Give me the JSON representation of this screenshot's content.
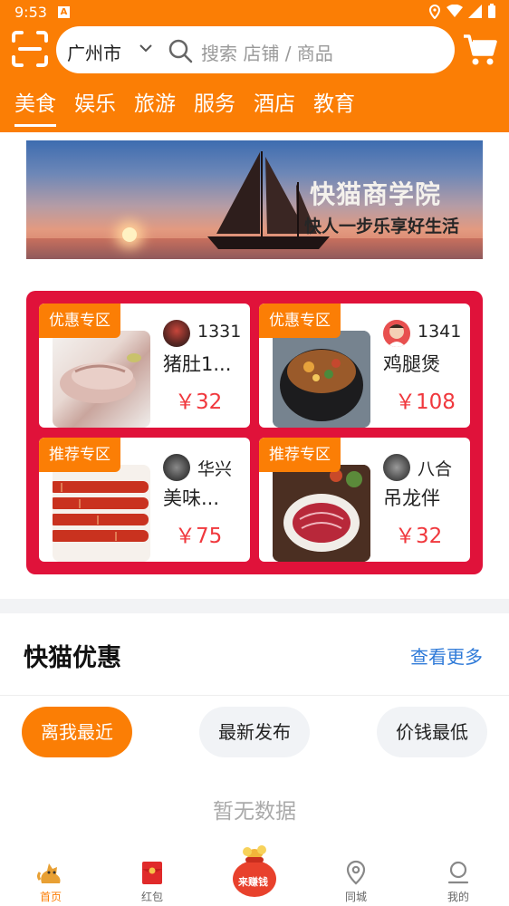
{
  "status_bar": {
    "time": "9:53",
    "app_badge": "A"
  },
  "header": {
    "city": "广州市",
    "search_placeholder": "搜索 店铺 / 商品",
    "categories": [
      {
        "label": "美食",
        "active": true
      },
      {
        "label": "娱乐",
        "active": false
      },
      {
        "label": "旅游",
        "active": false
      },
      {
        "label": "服务",
        "active": false
      },
      {
        "label": "酒店",
        "active": false
      },
      {
        "label": "教育",
        "active": false
      }
    ],
    "accent_color": "#fb7e05"
  },
  "banner": {
    "title": "快猫商学院",
    "subtitle": "快人一步乐享好生活"
  },
  "promos": [
    {
      "tag": "优惠专区",
      "shop": "1331",
      "title": "猪肚1...",
      "price": "￥32"
    },
    {
      "tag": "优惠专区",
      "shop": "1341",
      "title": "鸡腿煲",
      "price": "￥108"
    },
    {
      "tag": "推荐专区",
      "shop": "华兴",
      "title": "美味...",
      "price": "￥75"
    },
    {
      "tag": "推荐专区",
      "shop": "八合",
      "title": "吊龙伴",
      "price": "￥32"
    }
  ],
  "section": {
    "title": "快猫优惠",
    "see_more": "查看更多"
  },
  "filters": [
    {
      "label": "离我最近",
      "active": true
    },
    {
      "label": "最新发布",
      "active": false
    },
    {
      "label": "价钱最低",
      "active": false
    }
  ],
  "empty_text": "暂无数据",
  "tabbar": {
    "items": [
      {
        "label": "首页",
        "icon": "cat-icon",
        "active": true
      },
      {
        "label": "红包",
        "icon": "red-envelope-icon",
        "active": false
      },
      {
        "label": "来赚钱",
        "icon": "money-bag-icon",
        "active": false
      },
      {
        "label": "同城",
        "icon": "location-pin-icon",
        "active": false
      },
      {
        "label": "我的",
        "icon": "profile-icon",
        "active": false
      }
    ]
  }
}
